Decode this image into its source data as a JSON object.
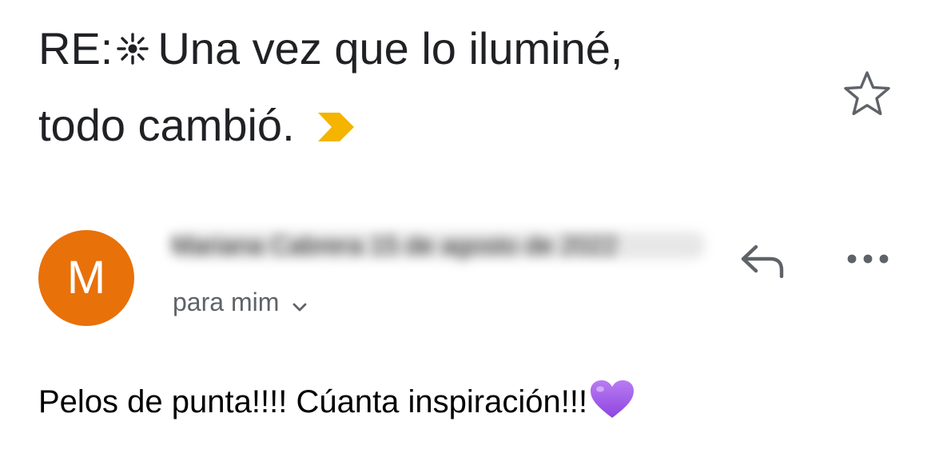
{
  "email": {
    "subject_prefix": "RE:",
    "subject_line1": "Una vez que lo iluminé,",
    "subject_line2": "todo cambió.",
    "sparkle_icon": "sparkle-icon",
    "importance_icon": "importance-marker-icon",
    "importance_color": "#f4b400",
    "star_icon": "star-outline-icon",
    "avatar_letter": "M",
    "avatar_color": "#e8710a",
    "sender_line": "Mariana Cabrera 15 de agosto de 2022",
    "recipient": "para mim",
    "recipient_chevron_icon": "chevron-down-icon",
    "reply_icon": "reply-icon",
    "more_icon": "more-horizontal-icon",
    "body": "Pelos de punta!!!! Cúanta inspiración!!!",
    "heart_icon": "purple-heart-icon",
    "heart_color": "#a259e6"
  }
}
